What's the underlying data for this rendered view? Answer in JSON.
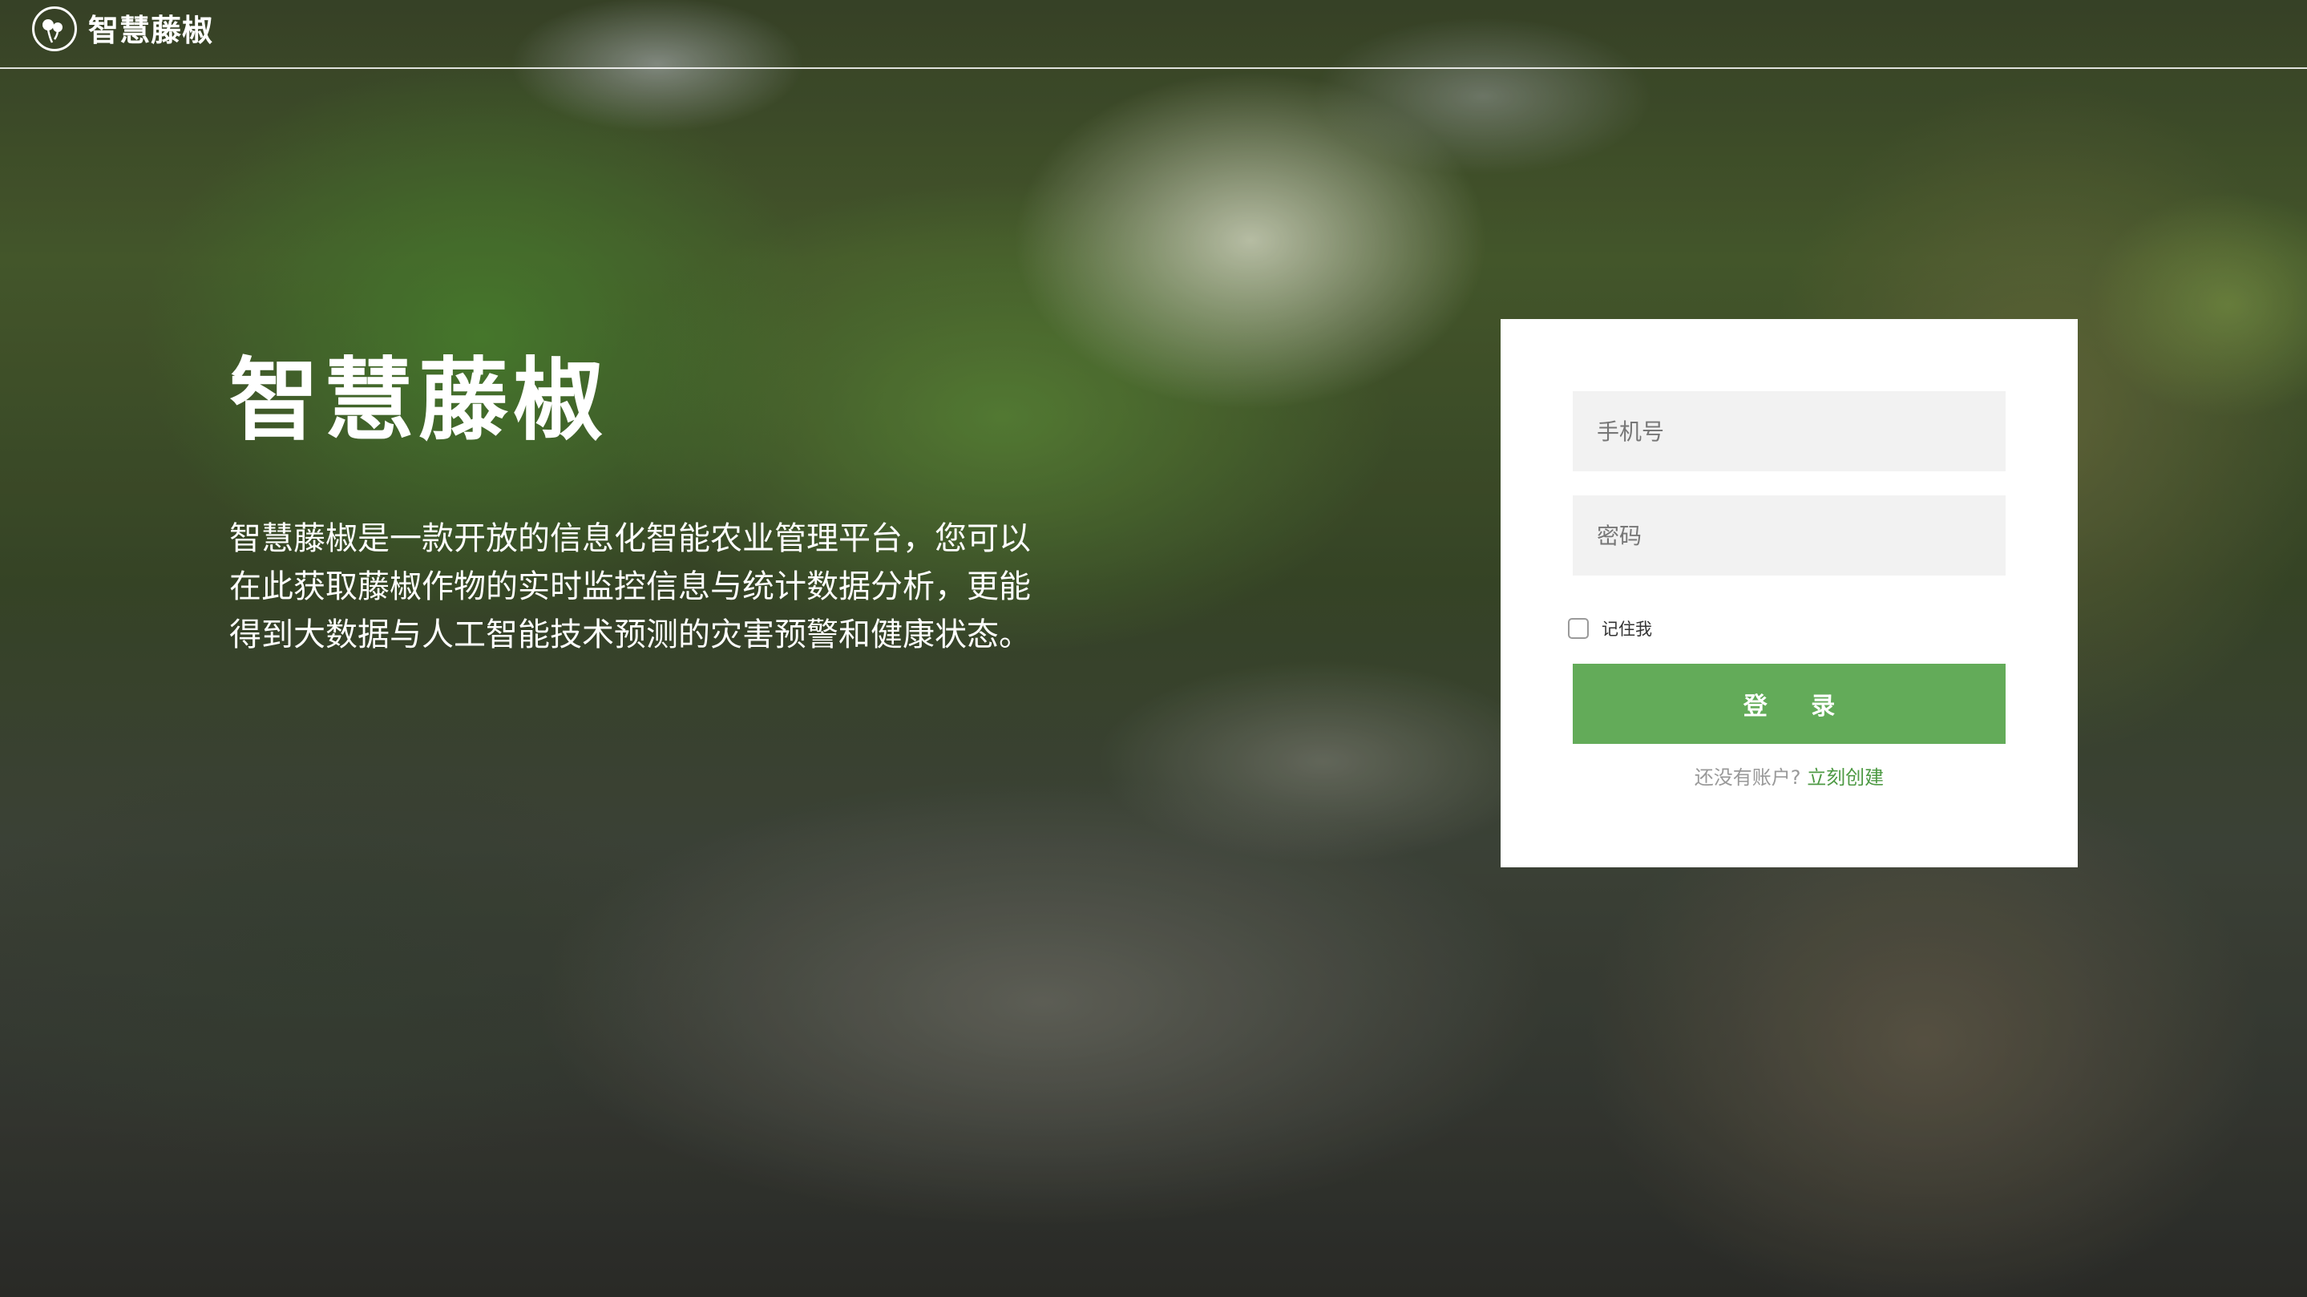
{
  "header": {
    "brand": "智慧藤椒",
    "logo_icon": "pepper-leaf-logo-icon"
  },
  "hero": {
    "title": "智慧藤椒",
    "description": "智慧藤椒是一款开放的信息化智能农业管理平台，您可以在此获取藤椒作物的实时监控信息与统计数据分析，更能得到大数据与人工智能技术预测的灾害预警和健康状态。"
  },
  "login": {
    "phone_placeholder": "手机号",
    "password_placeholder": "密码",
    "remember_label": "记住我",
    "remember_checked": false,
    "submit_label": "登 录",
    "signup_prompt": "还没有账户?",
    "signup_link": "立刻创建"
  },
  "colors": {
    "accent": "#63ab59",
    "link": "#4e9a44",
    "card_background": "#ffffff",
    "field_background": "#f2f2f2"
  }
}
